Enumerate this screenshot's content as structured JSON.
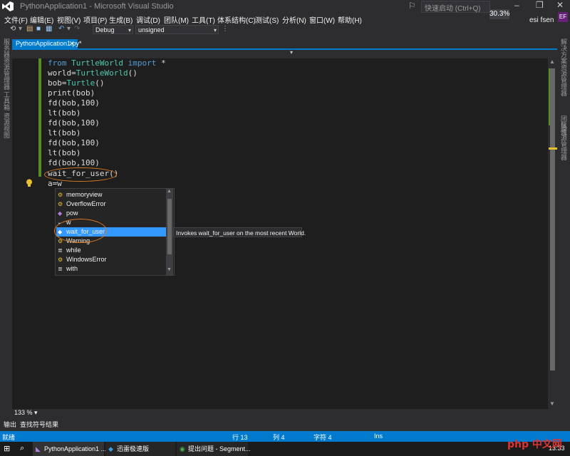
{
  "titlebar": {
    "title": "PythonApplication1 - Microsoft Visual Studio",
    "quick_launch_placeholder": "快速启动 (Ctrl+Q)",
    "zoom_badge": "30.3%",
    "controls": [
      "–",
      "❐",
      "✕"
    ]
  },
  "menu": {
    "items": [
      "文件(F)",
      "编辑(E)",
      "视图(V)",
      "项目(P)",
      "生成(B)",
      "调试(D)",
      "团队(M)",
      "工具(T)",
      "体系结构(C)",
      "测试(S)",
      "分析(N)",
      "窗口(W)",
      "帮助(H)"
    ],
    "user_name": "esi fsen",
    "user_initials": "EF"
  },
  "toolbar": {
    "configuration": "Debug",
    "platform": "unsigned"
  },
  "left_strip": {
    "tabs": [
      "服务器资源管理器",
      "工具箱",
      "资源视图"
    ]
  },
  "right_strip": {
    "tabs": [
      "解决方案资源管理器",
      "团队资源管理器",
      "属性"
    ]
  },
  "document_tab": {
    "label": "PythonApplication1.py*",
    "close": "✕"
  },
  "code": {
    "line1_kw1": "from",
    "line1_mod": "TurtleWorld",
    "line1_kw2": "import",
    "line1_rest": " *",
    "line2_a": "world=",
    "line2_cls": "TurtleWorld",
    "line2_b": "()",
    "line3_a": "bob=",
    "line3_cls": "Turtle",
    "line3_b": "()",
    "line4": "print(bob)",
    "line5": "fd(bob,100)",
    "line6": "lt(bob)",
    "line7": "fd(bob,100)",
    "line8": "lt(bob)",
    "line9": "fd(bob,100)",
    "line10": "lt(bob)",
    "line11": "fd(bob,100)",
    "line12": "wait_for_user()",
    "line13": "a=w"
  },
  "completion": {
    "items": [
      {
        "icon": "class-icon",
        "label": "memoryview"
      },
      {
        "icon": "class-icon",
        "label": "OverflowError"
      },
      {
        "icon": "function-icon",
        "label": "pow"
      },
      {
        "icon": "variable-icon",
        "label": "w"
      },
      {
        "icon": "function-icon",
        "label": "wait_for_user"
      },
      {
        "icon": "class-icon",
        "label": "Warning"
      },
      {
        "icon": "keyword-icon",
        "label": "while"
      },
      {
        "icon": "class-icon",
        "label": "WindowsError"
      },
      {
        "icon": "keyword-icon",
        "label": "with"
      }
    ],
    "selected_index": 4,
    "tooltip": "Invokes wait_for_user on the most recent World."
  },
  "zoom": "133 %",
  "output_tabs": [
    "输出",
    "查找符号结果"
  ],
  "status": {
    "ready": "就绪",
    "line": "行 13",
    "col": "列 4",
    "char": "字符 4",
    "mode": "Ins"
  },
  "taskbar": {
    "items": [
      "PythonApplication1 ...",
      "迅雷极速版",
      "提出问题 - Segment..."
    ],
    "clock": "13:33",
    "watermark": "php 中文网"
  },
  "colors": {
    "accent": "#007acc",
    "highlight_circle": "#e07a20",
    "selection": "#3399ff"
  }
}
